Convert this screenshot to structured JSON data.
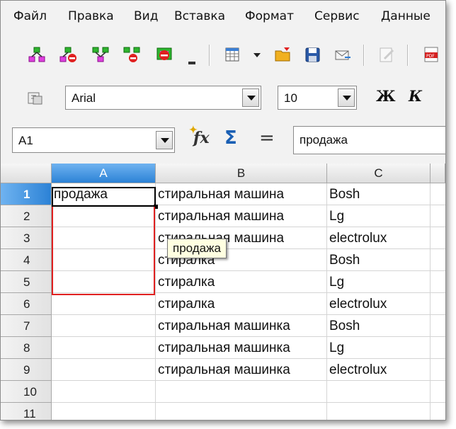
{
  "menu": [
    "Файл",
    "Правка",
    "Вид",
    "Вставка",
    "Формат",
    "Сервис",
    "Данные"
  ],
  "toolbar2": {
    "font_name": "Arial",
    "font_size": "10",
    "bold": "Ж",
    "italic": "К"
  },
  "formula_bar": {
    "cell_ref": "A1",
    "fx_label": "fx",
    "sigma_label": "Σ",
    "equals_label": "=",
    "content": "продажа"
  },
  "columns": [
    "A",
    "B",
    "C"
  ],
  "rows": [
    "1",
    "2",
    "3",
    "4",
    "5",
    "6",
    "7",
    "8",
    "9",
    "10",
    "11"
  ],
  "cells": {
    "A": [
      "продажа",
      "",
      "",
      "",
      "",
      "",
      "",
      "",
      ""
    ],
    "B": [
      "стиральная машина",
      "стиральная машина",
      "стиральная машина",
      "стиралка",
      "стиралка",
      "стиралка",
      "стиральная машинка",
      "стиральная машинка",
      "стиральная машинка"
    ],
    "C": [
      "Bosh",
      "Lg",
      "electrolux",
      "Bosh",
      "Lg",
      "electrolux",
      "Bosh",
      "Lg",
      "electrolux"
    ]
  },
  "tooltip": "продажа",
  "colors": {
    "selected_header": "#2c82d6",
    "selection_border": "#e02020",
    "tooltip_bg": "#ffffe1"
  }
}
